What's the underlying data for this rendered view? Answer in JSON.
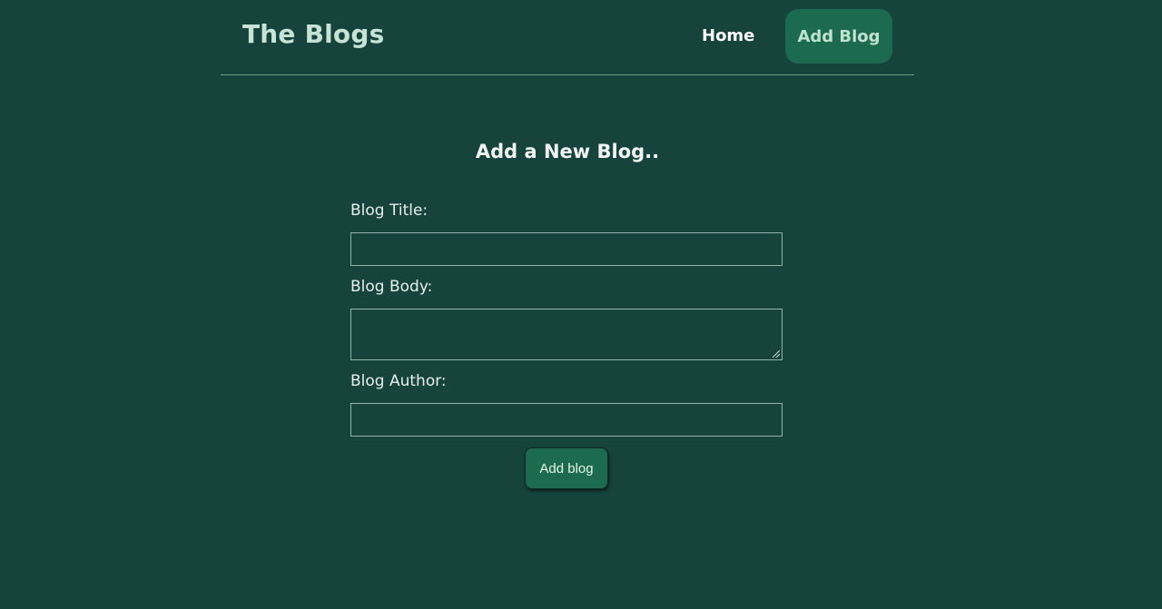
{
  "navbar": {
    "brand": "The Blogs",
    "links": [
      {
        "label": "Home"
      },
      {
        "label": "Add Blog"
      }
    ]
  },
  "form": {
    "title": "Add a New Blog..",
    "title_label": "Blog Title:",
    "title_value": "",
    "body_label": "Blog Body:",
    "body_value": "",
    "author_label": "Blog Author:",
    "author_value": "",
    "submit_label": "Add blog"
  },
  "colors": {
    "background": "#16433c",
    "accent": "#1c6a4f",
    "brand_text": "#c7e3d5"
  }
}
